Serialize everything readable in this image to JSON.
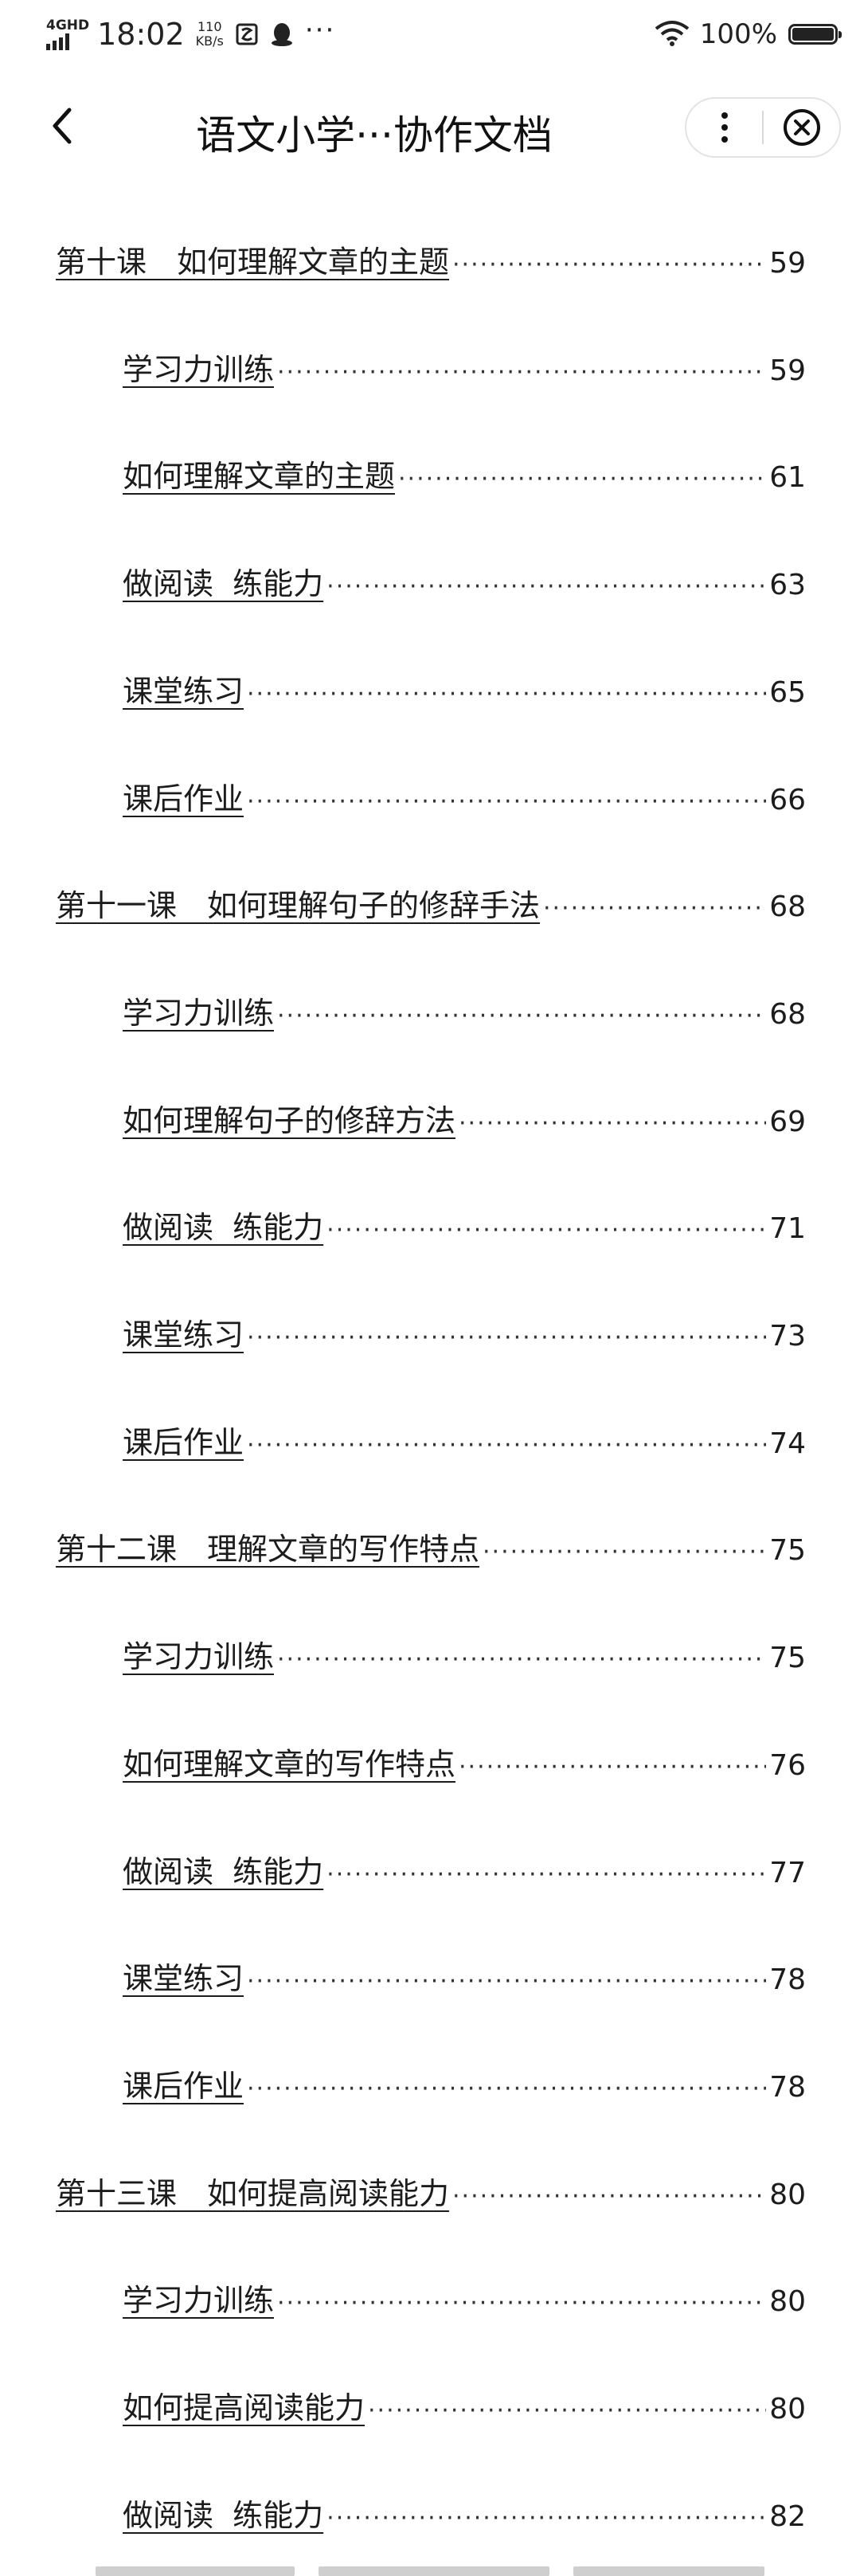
{
  "status_bar": {
    "network": "4GHD",
    "time": "18:02",
    "speed_value": "110",
    "speed_unit": "KB/s",
    "dots": "···",
    "battery_text": "100%",
    "battery_level": 1.0
  },
  "title_bar": {
    "title": "语文小学···协作文档",
    "icons": {
      "back": "chevron-left-icon",
      "more": "more-vertical-icon",
      "close": "close-circle-icon"
    }
  },
  "toc": {
    "leader": "··········································································································································",
    "entries": [
      {
        "level": 1,
        "label": "第十课　如何理解文章的主题",
        "page": "59"
      },
      {
        "level": 2,
        "label": "学习力训练",
        "page": "59"
      },
      {
        "level": 2,
        "label": "如何理解文章的主题",
        "page": "61"
      },
      {
        "level": 2,
        "label": "做阅读  练能力",
        "page": "63"
      },
      {
        "level": 2,
        "label": "课堂练习",
        "page": "65"
      },
      {
        "level": 2,
        "label": "课后作业",
        "page": "66"
      },
      {
        "level": 1,
        "label": "第十一课　如何理解句子的修辞手法",
        "page": "68"
      },
      {
        "level": 2,
        "label": "学习力训练",
        "page": "68"
      },
      {
        "level": 2,
        "label": "如何理解句子的修辞方法",
        "page": "69"
      },
      {
        "level": 2,
        "label": "做阅读  练能力",
        "page": "71"
      },
      {
        "level": 2,
        "label": "课堂练习",
        "page": "73"
      },
      {
        "level": 2,
        "label": "课后作业",
        "page": "74"
      },
      {
        "level": 1,
        "label": "第十二课　理解文章的写作特点",
        "page": "75"
      },
      {
        "level": 2,
        "label": "学习力训练",
        "page": "75"
      },
      {
        "level": 2,
        "label": "如何理解文章的写作特点",
        "page": "76"
      },
      {
        "level": 2,
        "label": "做阅读  练能力",
        "page": "77"
      },
      {
        "level": 2,
        "label": "课堂练习",
        "page": "78"
      },
      {
        "level": 2,
        "label": "课后作业",
        "page": "78"
      },
      {
        "level": 1,
        "label": "第十三课　如何提高阅读能力",
        "page": "80"
      },
      {
        "level": 2,
        "label": "学习力训练",
        "page": "80"
      },
      {
        "level": 2,
        "label": "如何提高阅读能力",
        "page": "80"
      },
      {
        "level": 2,
        "label": "做阅读  练能力",
        "page": "82"
      }
    ]
  },
  "colors": {
    "text": "#1c1c1c",
    "background": "#ffffff",
    "capsule_border": "#e3e3e3"
  }
}
